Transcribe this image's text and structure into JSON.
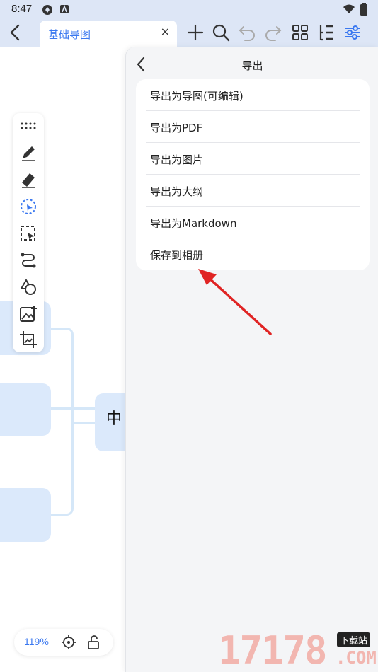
{
  "status_bar": {
    "time": "8:47"
  },
  "header": {
    "tab_title": "基础导图",
    "tab_close": "×",
    "icons": [
      "back-icon",
      "add-icon",
      "search-icon",
      "undo-icon",
      "redo-icon",
      "grid-icon",
      "outline-icon",
      "settings-sliders-icon"
    ]
  },
  "export_panel": {
    "title": "导出",
    "items": [
      {
        "label": "导出为导图(可编辑)"
      },
      {
        "label": "导出为PDF"
      },
      {
        "label": "导出为图片"
      },
      {
        "label": "导出为大纲"
      },
      {
        "label": "导出为Markdown"
      },
      {
        "label": "保存到相册"
      }
    ]
  },
  "canvas": {
    "center_node_text": "中",
    "zoom_level": "119%"
  },
  "toolbar": {
    "tools": [
      "more-dots-icon",
      "pen-icon",
      "eraser-icon",
      "lasso-select-icon",
      "box-select-icon",
      "connector-icon",
      "shapes-icon",
      "add-image-icon",
      "image-crop-icon"
    ]
  },
  "watermark": {
    "digits": "17178",
    "badge": "下载站",
    "suffix": ".COM"
  },
  "colors": {
    "accent": "#3a78f0",
    "node_fill": "#dbe9fb",
    "annotation_arrow": "#e02424"
  }
}
